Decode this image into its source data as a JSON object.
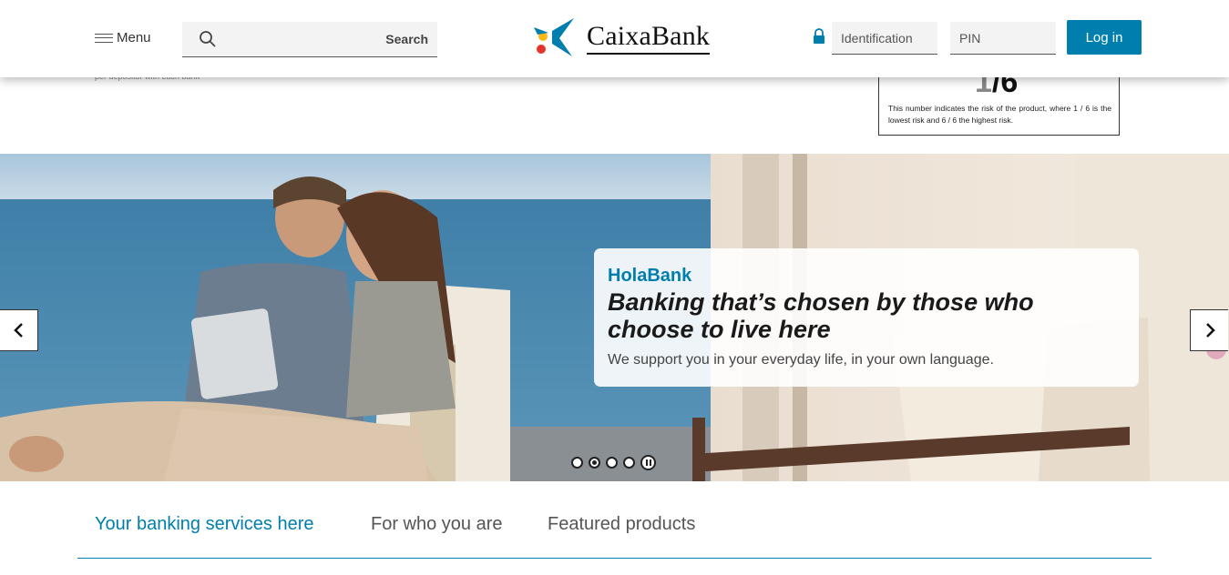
{
  "header": {
    "menu_label": "Menu",
    "search_label": "Search",
    "brand_name": "CaixaBank",
    "identification_placeholder": "Identification",
    "pin_placeholder": "PIN",
    "login_label": "Log in"
  },
  "background_content": {
    "partial_text": "per depositor with each bank",
    "risk_value_prefix": "1",
    "risk_value_suffix": "/6",
    "risk_description": "This number indicates the risk of the product, where 1 / 6 is the lowest risk and 6 / 6 the highest risk."
  },
  "hero": {
    "eyebrow": "HolaBank",
    "title": "Banking that’s chosen by those who choose to live here",
    "subtitle": "We support you in your everyday life, in your own language.",
    "slide_count": 4,
    "active_slide": 2
  },
  "tabs": [
    {
      "label": "Your banking services here",
      "active": true
    },
    {
      "label": "For who you are",
      "active": false
    },
    {
      "label": "Featured products",
      "active": false
    }
  ],
  "colors": {
    "accent": "#007eae",
    "text_dark": "#1a1a1a"
  },
  "icons": [
    "hamburger-icon",
    "search-icon",
    "caixabank-star-logo",
    "lock-icon",
    "chevron-left-icon",
    "chevron-right-icon",
    "pause-icon"
  ]
}
